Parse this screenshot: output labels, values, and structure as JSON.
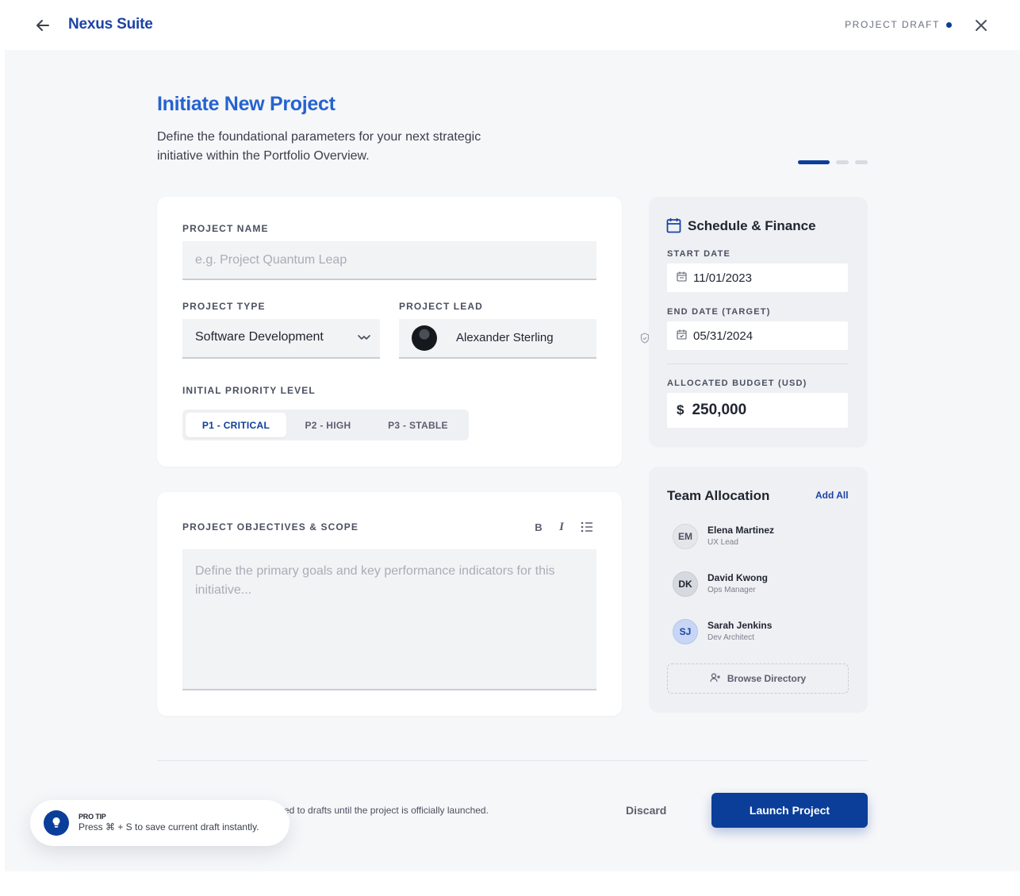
{
  "header": {
    "brand": "Nexus Suite",
    "status": "PROJECT DRAFT"
  },
  "page": {
    "title": "Initiate New Project",
    "subtitle": "Define the foundational parameters for your next strategic initiative within the Portfolio Overview.",
    "step_current": 1,
    "step_total": 3
  },
  "form": {
    "project_name_label": "PROJECT NAME",
    "project_name_placeholder": "e.g. Project Quantum Leap",
    "project_name_value": "",
    "project_type_label": "PROJECT TYPE",
    "project_type_value": "Software Development",
    "project_lead_label": "PROJECT LEAD",
    "project_lead_value": "Alexander Sterling",
    "priority_label": "INITIAL PRIORITY LEVEL",
    "priority_options": [
      "P1 - CRITICAL",
      "P2 - HIGH",
      "P3 - STABLE"
    ],
    "priority_selected": "P1 - CRITICAL",
    "objectives_label": "PROJECT OBJECTIVES & SCOPE",
    "objectives_placeholder": "Define the primary goals and key performance indicators for this initiative...",
    "objectives_value": "",
    "toolbar": {
      "bold": "B",
      "italic": "I"
    }
  },
  "schedule": {
    "title": "Schedule & Finance",
    "start_label": "START DATE",
    "start_value": "11/01/2023",
    "end_label": "END DATE (TARGET)",
    "end_value": "05/31/2024",
    "budget_label": "ALLOCATED BUDGET (USD)",
    "budget_currency": "$",
    "budget_value": "250,000"
  },
  "team": {
    "title": "Team Allocation",
    "add_all": "Add All",
    "members": [
      {
        "initials": "EM",
        "name": "Elena Martinez",
        "role": "UX Lead",
        "color": "#e4e6ea",
        "text_color": "#4b5060"
      },
      {
        "initials": "DK",
        "name": "David Kwong",
        "role": "Ops Manager",
        "color": "#d6d9df",
        "text_color": "#1f2430"
      },
      {
        "initials": "SJ",
        "name": "Sarah Jenkins",
        "role": "Dev Architect",
        "color": "#c7d6f5",
        "text_color": "#1d43a6"
      }
    ],
    "browse": "Browse Directory"
  },
  "footer": {
    "note": "ed to drafts until the project is officially launched.",
    "discard": "Discard",
    "launch": "Launch Project"
  },
  "toast": {
    "title": "PRO TIP",
    "message": "Press ⌘ + S to save current draft instantly."
  },
  "colors": {
    "primary": "#0b3e99",
    "accent": "#2563cf"
  }
}
